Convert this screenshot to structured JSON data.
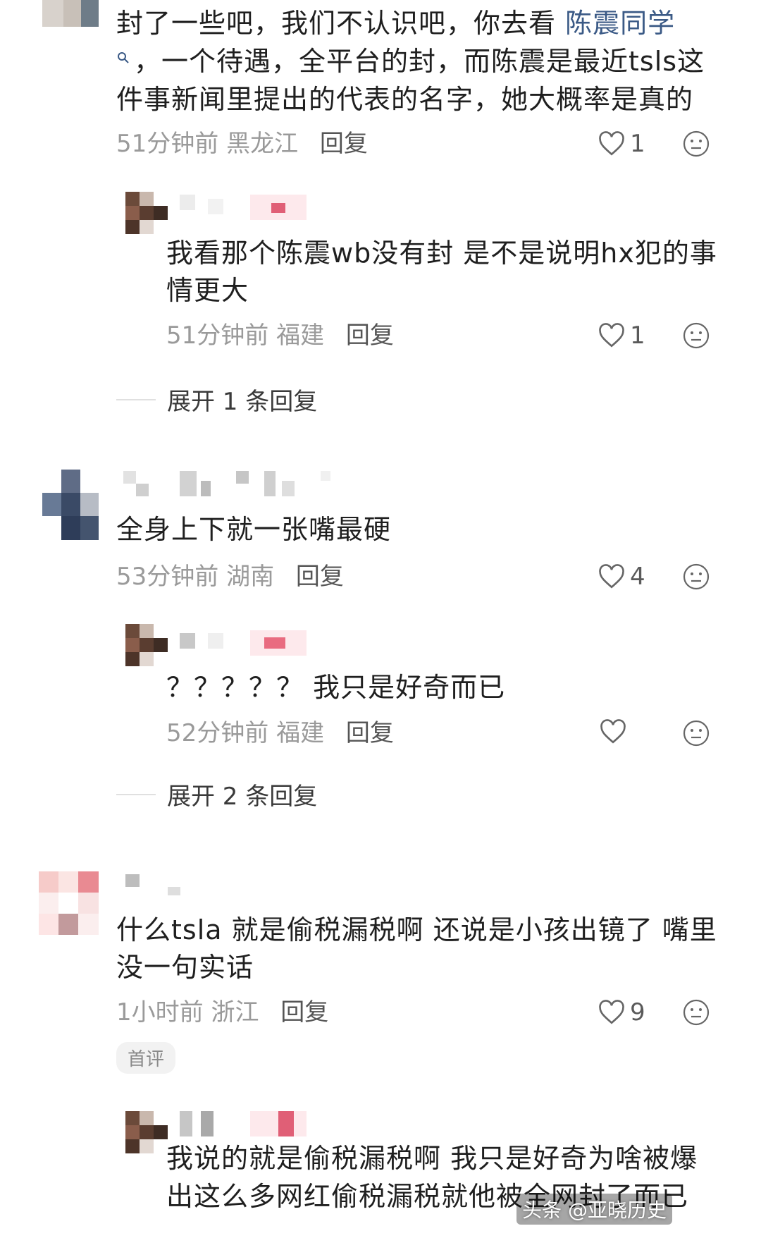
{
  "comments": [
    {
      "text_lines": [
        "封了一些吧，我们不认识吧，你去看 ",
        "，一个待遇，全平台的封，而陈震是最近tsls这",
        "件事新闻里提出的代表的名字，她大概率是真的"
      ],
      "link_text": "陈震同学",
      "time": "51分钟前",
      "location": "黑龙江",
      "reply_label": "回复",
      "likes": "1"
    },
    {
      "text_lines": [
        "我看那个陈震wb没有封 是不是说明hx犯的事",
        "情更大"
      ],
      "time": "51分钟前",
      "location": "福建",
      "reply_label": "回复",
      "likes": "1"
    },
    {
      "expand_label": "展开 1 条回复"
    },
    {
      "text_lines": [
        "全身上下就一张嘴最硬"
      ],
      "time": "53分钟前",
      "location": "湖南",
      "reply_label": "回复",
      "likes": "4"
    },
    {
      "text_lines": [
        "？？？？？ 我只是好奇而已"
      ],
      "time": "52分钟前",
      "location": "福建",
      "reply_label": "回复",
      "likes": ""
    },
    {
      "expand_label": "展开 2 条回复"
    },
    {
      "text_lines": [
        "什么tsla 就是偷税漏税啊 还说是小孩出镜了 嘴里",
        "没一句实话"
      ],
      "time": "1小时前",
      "location": "浙江",
      "reply_label": "回复",
      "likes": "9",
      "badge": "首评"
    },
    {
      "text_lines": [
        "我说的就是偷税漏税啊 我只是好奇为啥被爆",
        "出这么多网红偷税漏税就他被全网封了而已"
      ]
    }
  ],
  "watermark": {
    "text": "头条 @亚晓历史"
  },
  "icons": {
    "like": "heart-outline-icon",
    "emoji": "neutral-face-icon",
    "search": "search-icon"
  },
  "colors": {
    "text": "#1f1f1f",
    "meta": "#9a9a9a",
    "link": "#3b5a86"
  }
}
